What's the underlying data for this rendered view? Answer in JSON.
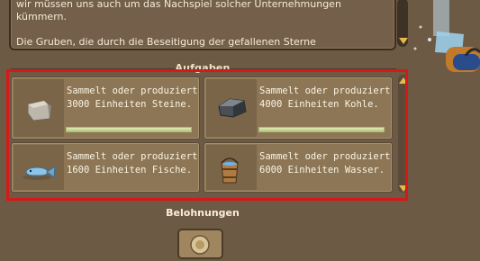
{
  "story": {
    "lines": [
      "wir müssen uns auch um das Nachspiel solcher Unternehmungen kümmern.",
      "Die Gruben, die durch die Beseitigung der gefallenen Sterne"
    ]
  },
  "tasks": {
    "title": "Aufgaben",
    "items": [
      {
        "text": "Sammelt oder produziert 3000 Einheiten Steine.",
        "icon": "stone-icon",
        "progress": 0.0
      },
      {
        "text": "Sammelt oder produziert 4000 Einheiten Kohle.",
        "icon": "coal-icon",
        "progress": 0.0
      },
      {
        "text": "Sammelt oder produziert 1600 Einheiten Fische.",
        "icon": "fish-icon"
      },
      {
        "text": "Sammelt oder produziert 6000 Einheiten Wasser.",
        "icon": "water-bucket-icon"
      }
    ]
  },
  "rewards": {
    "title": "Belohnungen"
  },
  "colors": {
    "highlight": "#d81818",
    "scroll_arrow": "#e8b84a",
    "panel_bg": "#6d5a44"
  }
}
